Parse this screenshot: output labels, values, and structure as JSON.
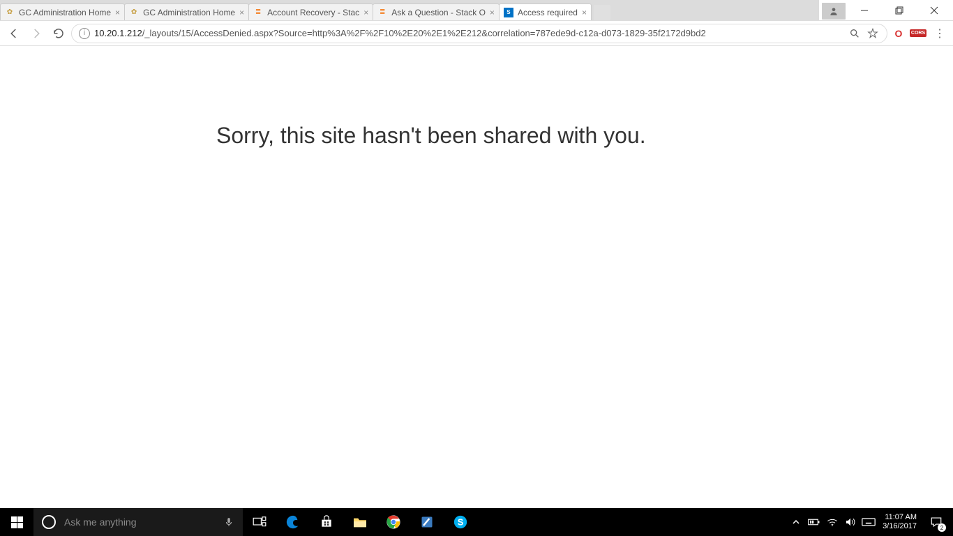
{
  "tabs": [
    {
      "label": "GC Administration Home",
      "icon": "gold"
    },
    {
      "label": "GC Administration Home",
      "icon": "gold"
    },
    {
      "label": "Account Recovery - Stac",
      "icon": "so"
    },
    {
      "label": "Ask a Question - Stack O",
      "icon": "so"
    },
    {
      "label": "Access required",
      "icon": "sp",
      "active": true
    }
  ],
  "url": {
    "host": "10.20.1.212",
    "path": "/_layouts/15/AccessDenied.aspx?Source=http%3A%2F%2F10%2E20%2E1%2E212&correlation=787ede9d-c12a-d073-1829-35f2172d9bd2"
  },
  "page": {
    "message": "Sorry, this site hasn't been shared with you."
  },
  "cortana": {
    "placeholder": "Ask me anything"
  },
  "extensions": {
    "cors_label": "CORS"
  },
  "tray": {
    "time": "11:07 AM",
    "date": "3/16/2017",
    "notif_count": "2"
  }
}
